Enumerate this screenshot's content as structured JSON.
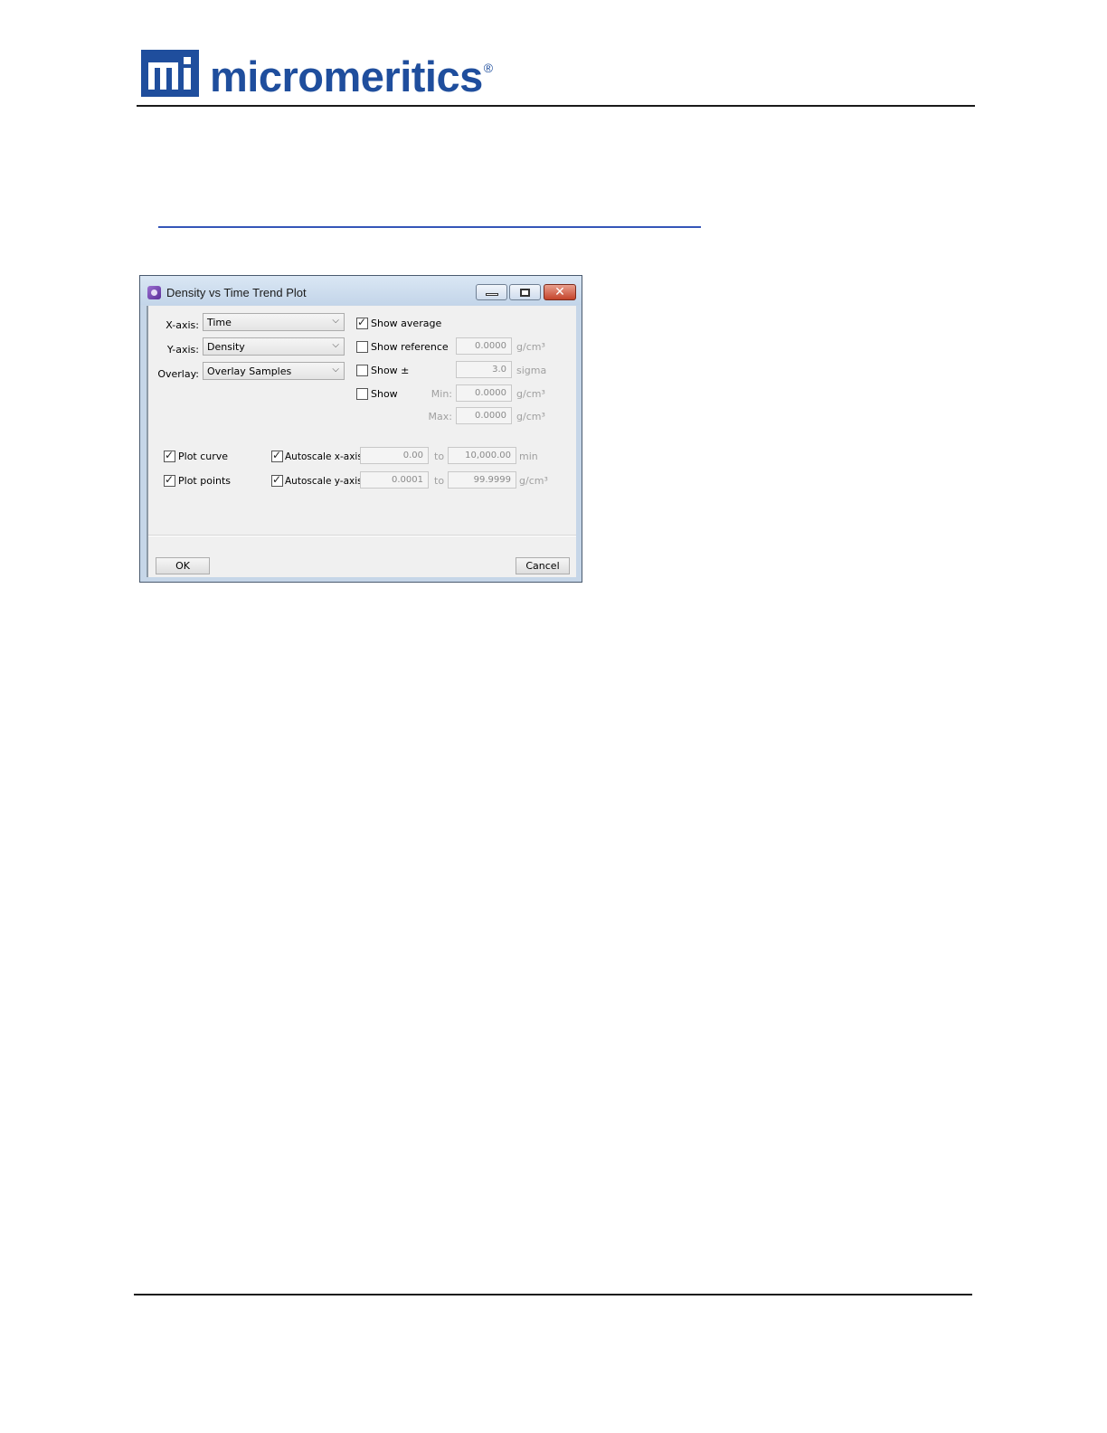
{
  "header": {
    "logo_text": "micromeritics",
    "logo_registered": "®"
  },
  "dialog": {
    "title": "Density vs Time Trend Plot",
    "x_axis": {
      "label": "X-axis:",
      "value": "Time"
    },
    "y_axis": {
      "label": "Y-axis:",
      "value": "Density"
    },
    "overlay": {
      "label": "Overlay:",
      "value": "Overlay Samples"
    },
    "show_average": {
      "label": "Show average",
      "checked": true
    },
    "show_reference": {
      "label": "Show reference",
      "checked": false,
      "value": "0.0000",
      "unit": "g/cm³"
    },
    "show_pm": {
      "label": "Show ±",
      "checked": false,
      "value": "3.0",
      "unit": "sigma"
    },
    "show_range": {
      "label": "Show",
      "checked": false,
      "min_label": "Min:",
      "min_value": "0.0000",
      "min_unit": "g/cm³",
      "max_label": "Max:",
      "max_value": "0.0000",
      "max_unit": "g/cm³"
    },
    "plot_curve": {
      "label": "Plot curve",
      "checked": true
    },
    "plot_points": {
      "label": "Plot points",
      "checked": true
    },
    "autoscale_x": {
      "label": "Autoscale x-axis:",
      "checked": true,
      "from": "0.00",
      "to_label": "to",
      "to": "10,000.00",
      "unit": "min"
    },
    "autoscale_y": {
      "label": "Autoscale y-axis:",
      "checked": true,
      "from": "0.0001",
      "to_label": "to",
      "to": "99.9999",
      "unit": "g/cm³"
    },
    "ok_label": "OK",
    "cancel_label": "Cancel"
  },
  "icons": {
    "window_controls": [
      "minimize-icon",
      "maximize-icon",
      "close-icon"
    ],
    "combo_arrow": "chevron-down-icon",
    "checkmark": "check-icon"
  },
  "colors": {
    "brand": "#1f4e9d",
    "title_bar": "#c6d6e8",
    "close_button": "#c4432b",
    "link_rule": "#3556b8"
  }
}
